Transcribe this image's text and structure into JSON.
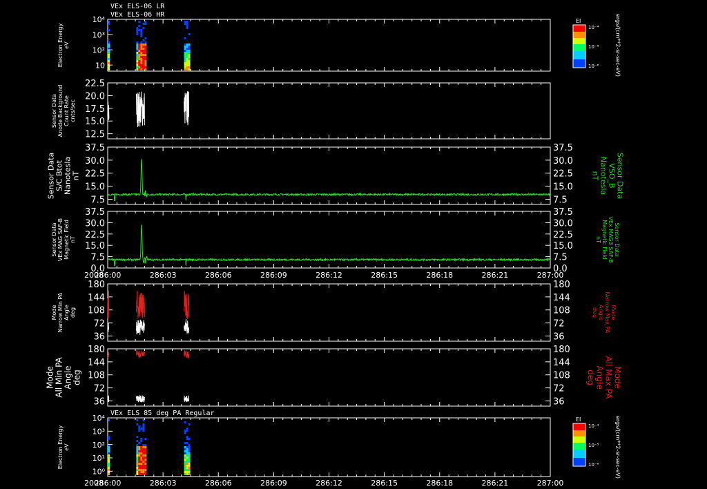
{
  "header": {
    "line1": "VEx ELS-06 LR",
    "line2": "VEx ELS-06 HR"
  },
  "colors": {
    "white": "#ffffff",
    "green": "#22dd22",
    "red": "#dd2222",
    "grey": "#999999",
    "bg": "#000000"
  },
  "chart_data": [
    {
      "type": "heatmap",
      "id": "els-spectrogram",
      "ylabel_lines": [
        "Electron Energy",
        "eV"
      ],
      "yticks": [
        "10⁴",
        "10³",
        "10²",
        "10"
      ],
      "colorbar": {
        "label": "EI",
        "ticks": [
          "10⁻⁴",
          "10⁻⁵",
          "10⁻⁶"
        ],
        "units": "ergs/(cm**2-sr-sec-eV)"
      },
      "data_blocks": [
        [
          286.0,
          286.003
        ],
        [
          286.0645,
          286.0835
        ],
        [
          286.1725,
          286.1835
        ]
      ]
    },
    {
      "type": "line",
      "id": "anode-background",
      "ylabel_lines": [
        "Sensor Data",
        "Anode Background",
        "Count Rate",
        "cnts/sec"
      ],
      "ylim": [
        10.5,
        22.5
      ],
      "yticks": [
        "22.5",
        "20.0",
        "17.5",
        "15.0",
        "12.5"
      ],
      "series": [
        {
          "color": "white",
          "segments": [
            [
              286.0,
              286.003
            ],
            [
              286.0645,
              286.0835
            ],
            [
              286.1725,
              286.1835
            ]
          ]
        }
      ]
    },
    {
      "type": "line",
      "id": "scbtot",
      "ylabel_lines": [
        "Sensor Data",
        "S/C Btot",
        "Nanotesla",
        "nT"
      ],
      "rlabel_lines": [
        "Sensor Data",
        "VSO_B",
        "Nanotesla",
        "nT"
      ],
      "ylim": [
        0,
        37.5
      ],
      "yticks": [
        "37.5",
        "30.0",
        "22.5",
        "15.0",
        "7.5"
      ],
      "series": [
        {
          "color": "green",
          "baseline": 6.5
        }
      ]
    },
    {
      "type": "line",
      "id": "mag-saf",
      "ylabel_lines": [
        "Sensor Data",
        "VEx MAG SAF-B",
        "Magnetic Field",
        "nT"
      ],
      "rlabel_lines": [
        "Sensor Data",
        "VEx MAG3 SAF-B",
        "Magnetic Field",
        "nT"
      ],
      "ylim": [
        0,
        37.5
      ],
      "yticks": [
        "37.5",
        "30.0",
        "22.5",
        "15.0",
        "7.5",
        "0.0"
      ],
      "series": [
        {
          "color": "green",
          "baseline": 5.5
        }
      ]
    },
    {
      "type": "line",
      "id": "narrow-pa",
      "ylabel_lines": [
        "Mode",
        "Narrow Min PA",
        "Angle",
        "deg"
      ],
      "rlabel_lines": [
        "Mode",
        "Narrow Max PA",
        "Angle",
        "deg"
      ],
      "ylim": [
        0,
        180
      ],
      "yticks": [
        "180",
        "144",
        "108",
        "72",
        "36"
      ],
      "series": [
        {
          "color": "white",
          "name": "Min"
        },
        {
          "color": "red",
          "name": "Max"
        }
      ]
    },
    {
      "type": "line",
      "id": "all-pa",
      "ylabel_lines": [
        "Mode",
        "All Min PA",
        "Angle",
        "deg"
      ],
      "rlabel_lines": [
        "Mode",
        "All Max PA",
        "Angle",
        "deg"
      ],
      "ylim": [
        0,
        180
      ],
      "yticks": [
        "180",
        "144",
        "108",
        "72",
        "36"
      ],
      "series": [
        {
          "color": "white",
          "name": "Min"
        },
        {
          "color": "red",
          "name": "Max"
        }
      ]
    },
    {
      "type": "heatmap",
      "id": "els-85deg",
      "title": "VEx ELS 85 deg PA Regular",
      "ylabel_lines": [
        "Electron Energy",
        "eV"
      ],
      "yticks": [
        "10⁴",
        "10³",
        "10²",
        "10¹",
        "10⁰"
      ],
      "colorbar": {
        "label": "EI",
        "ticks": [
          "10⁻⁴",
          "10⁻⁵",
          "10⁻⁶"
        ],
        "units": "ergs/(cm**2-sr-sec-eV)"
      },
      "data_blocks": [
        [
          286.0,
          286.003
        ],
        [
          286.0645,
          286.0835
        ],
        [
          286.1725,
          286.1835
        ]
      ]
    }
  ],
  "time_axis": {
    "year": "2008",
    "ticks": [
      "286:00",
      "286:03",
      "286:06",
      "286:09",
      "286:12",
      "286:15",
      "286:18",
      "286:21",
      "287:00"
    ],
    "range": [
      286.0,
      287.0
    ]
  }
}
